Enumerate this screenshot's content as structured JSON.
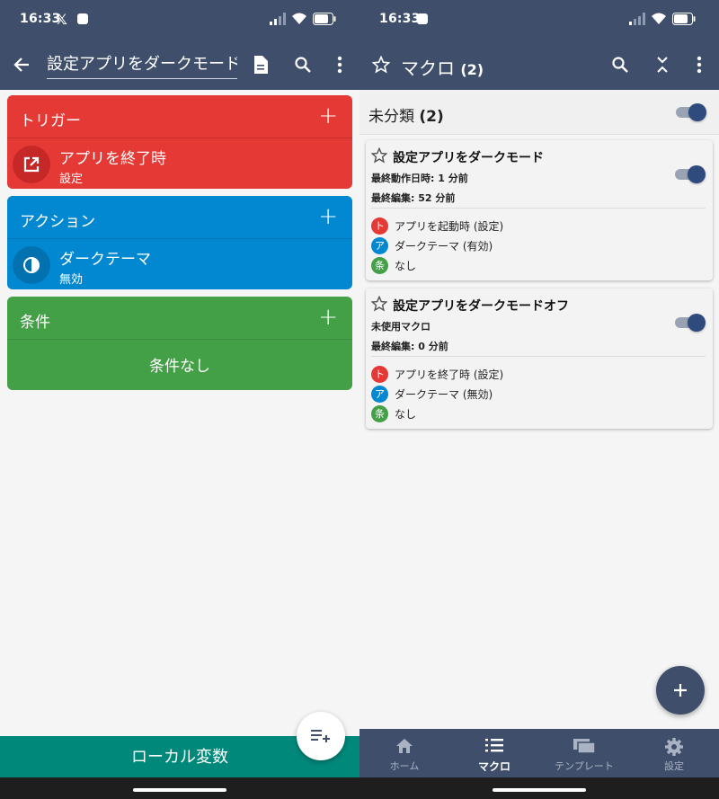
{
  "left": {
    "status": {
      "time": "16:33"
    },
    "appbar": {
      "title": "設定アプリをダークモード:"
    },
    "trigger_card": {
      "title": "トリガー",
      "plus": "+",
      "item_title": "アプリを終了時",
      "item_sub": "設定",
      "color": "#e53935"
    },
    "action_card": {
      "title": "アクション",
      "plus": "+",
      "item_title": "ダークテーマ",
      "item_sub": "無効",
      "color": "#0288d1"
    },
    "condition_card": {
      "title": "条件",
      "plus": "+",
      "empty": "条件なし",
      "color": "#43a047"
    },
    "local_variables_label": "ローカル変数"
  },
  "right": {
    "status": {
      "time": "16:33"
    },
    "appbar": {
      "title": "マクロ",
      "count": "(2)"
    },
    "category": {
      "title": "未分類",
      "count": "(2)"
    },
    "macros": [
      {
        "title": "設定アプリをダークモード",
        "line1": "最終動作日時: 1 分前",
        "line2": "最終編集: 52 分前",
        "trigger": "アプリを起動時 (設定)",
        "action": "ダークテーマ (有効)",
        "condition": "なし"
      },
      {
        "title": "設定アプリをダークモードオフ",
        "line1": "未使用マクロ",
        "line2": "最終編集: 0 分前",
        "trigger": "アプリを終了時 (設定)",
        "action": "ダークテーマ (無効)",
        "condition": "なし"
      }
    ],
    "badges": {
      "trigger": "ト",
      "action": "ア",
      "condition": "条"
    },
    "fab": "+",
    "nav": [
      {
        "label": "ホーム",
        "icon": "home-icon"
      },
      {
        "label": "マクロ",
        "icon": "list-icon"
      },
      {
        "label": "テンプレート",
        "icon": "template-icon"
      },
      {
        "label": "設定",
        "icon": "gear-icon"
      }
    ]
  },
  "colors": {
    "appbar": "#3f4f6b",
    "trigger": "#e53935",
    "action": "#0288d1",
    "condition": "#43a047",
    "local_var": "#00897b"
  }
}
